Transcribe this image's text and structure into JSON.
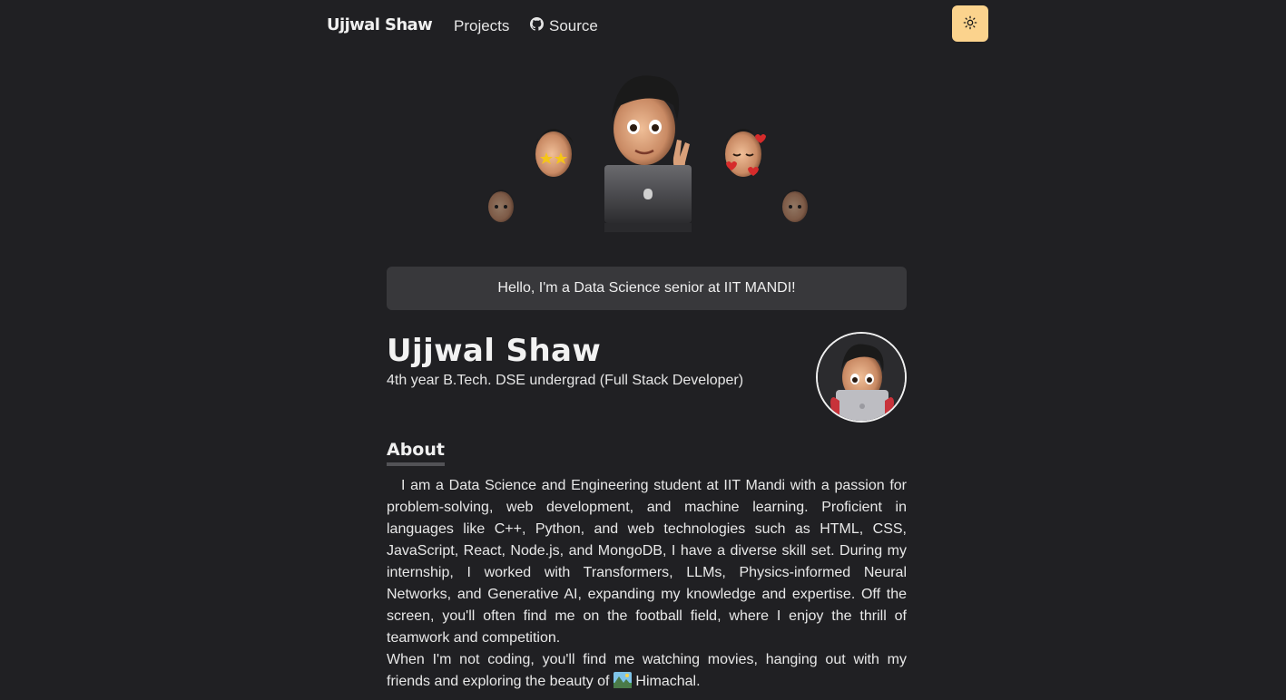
{
  "nav": {
    "brand": "Ujjwal Shaw",
    "links": [
      {
        "label": "Projects"
      },
      {
        "label": "Source",
        "icon": "github-icon"
      }
    ],
    "theme_toggle_icon": "sun-icon",
    "theme_toggle_color": "#fbd38d"
  },
  "greeting": "Hello, I'm a Data Science senior at IIT MANDI!",
  "profile": {
    "name": "Ujjwal Shaw",
    "subtitle": "4th year B.Tech. DSE undergrad (Full Stack Developer)"
  },
  "about": {
    "heading": "About",
    "paragraph1": "I am a Data Science and Engineering student at IIT Mandi with a passion for problem-solving, web development, and machine learning. Proficient in languages like C++, Python, and web technologies such as HTML, CSS, JavaScript, React, Node.js, and MongoDB, I have a diverse skill set. During my internship, I worked with Transformers, LLMs, Physics-informed Neural Networks, and Generative AI, expanding my knowledge and expertise. Off the screen, you'll often find me on the football field, where I enjoy the thrill of teamwork and competition.",
    "paragraph2_before": "When I'm not coding, you'll find me watching movies, hanging out with my friends and exploring the beauty of ",
    "paragraph2_emoji": "mountain-landscape-emoji",
    "paragraph2_after": " Himachal."
  },
  "colors": {
    "background": "#202023",
    "card": "#38383b",
    "accent": "#fbd38d"
  }
}
